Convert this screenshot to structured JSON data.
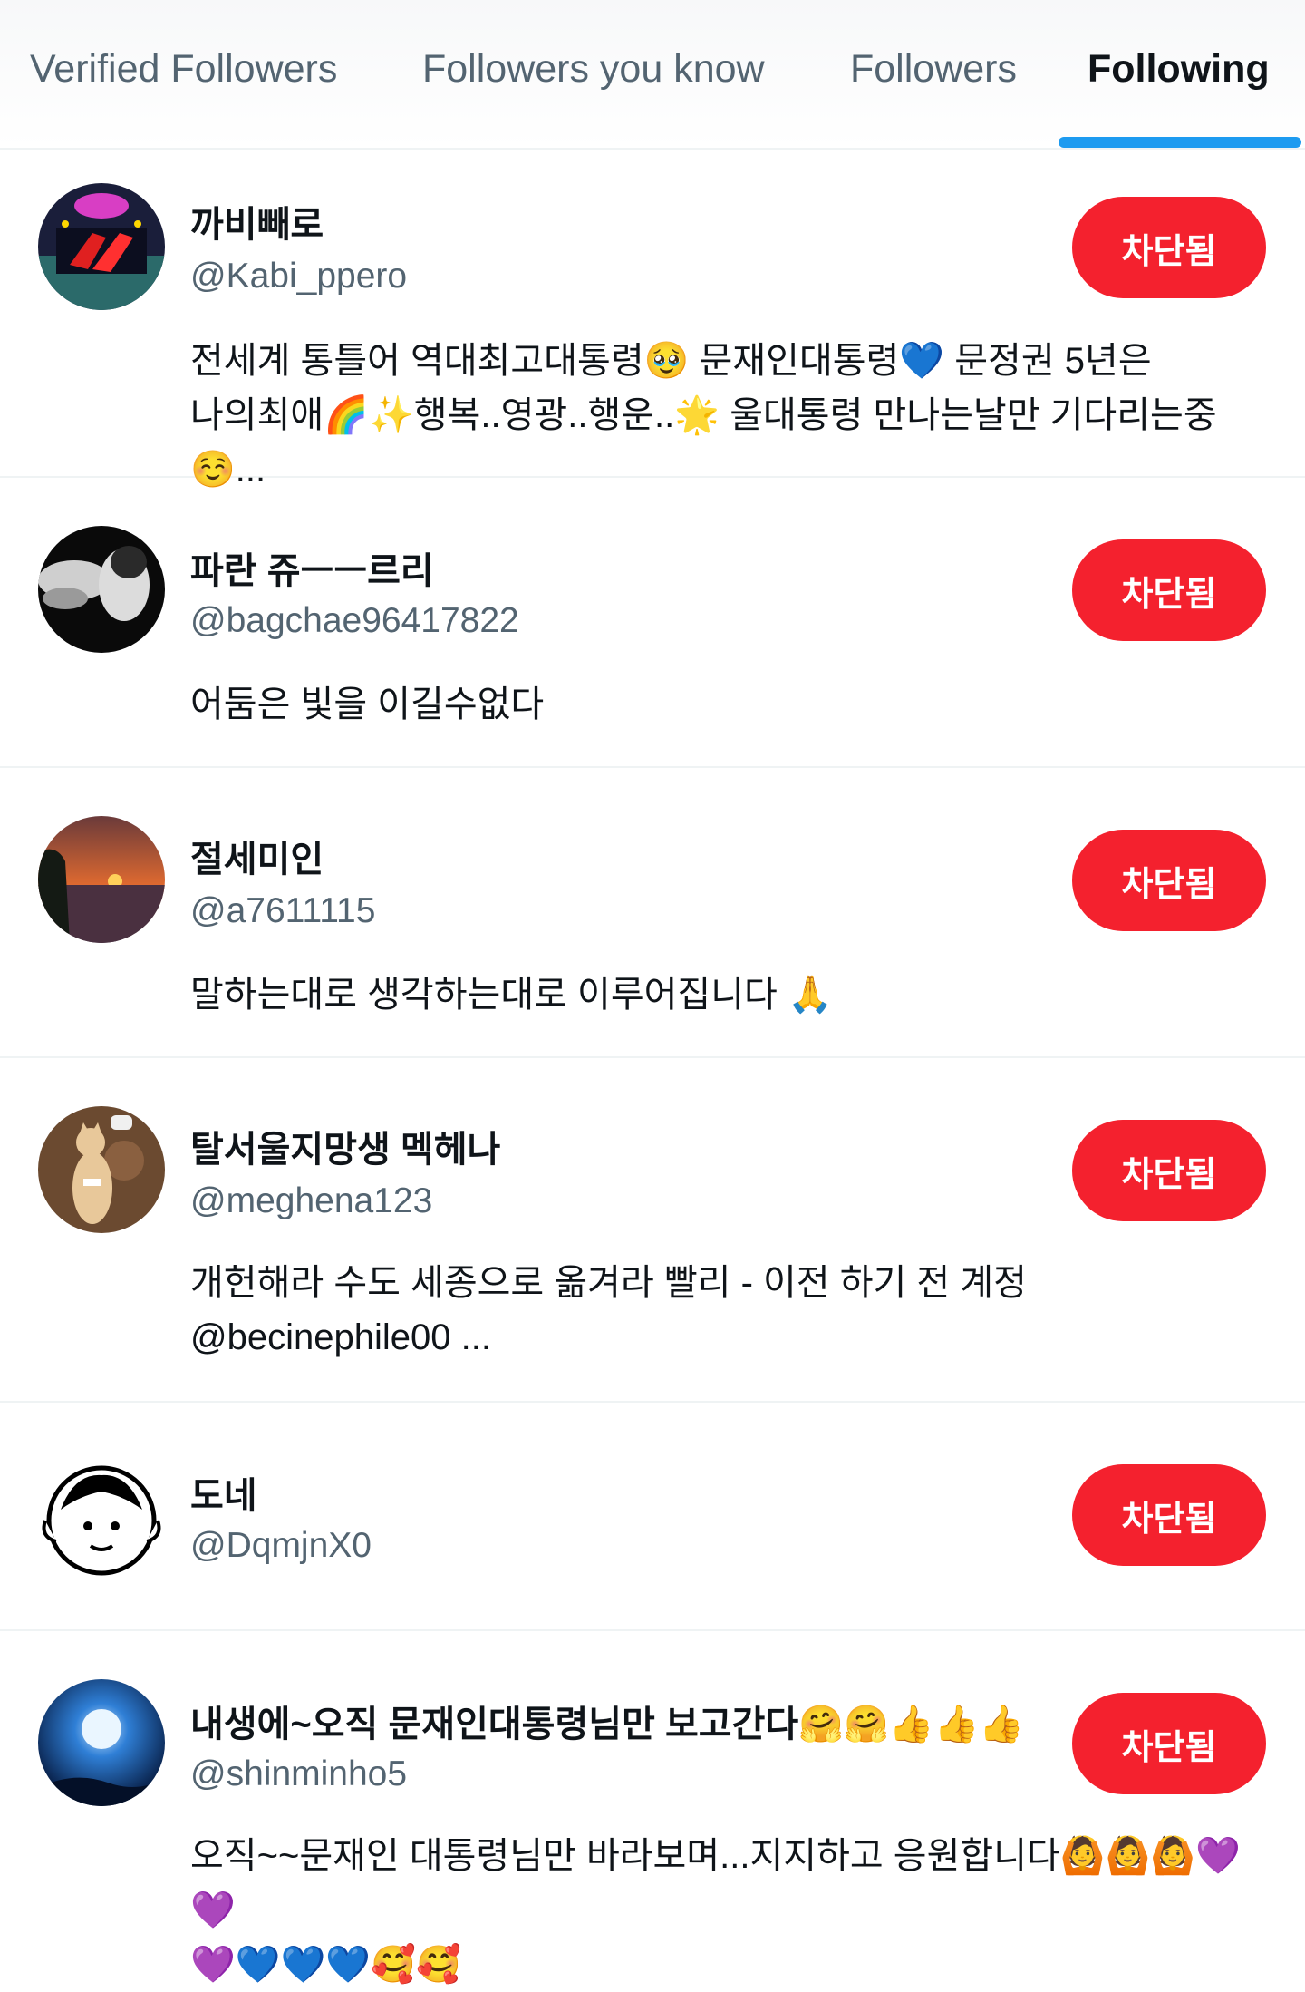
{
  "tabs": [
    {
      "label": "Verified Followers"
    },
    {
      "label": "Followers you know"
    },
    {
      "label": "Followers"
    },
    {
      "label": "Following"
    }
  ],
  "active_tab": "Following",
  "accent_color": "#1d9bf0",
  "block_button_color": "#f4212e",
  "users": [
    {
      "name": "까비빼로",
      "handle": "@Kabi_ppero",
      "bio": "전세계 통틀어 역대최고대통령🥹 문재인대통령💙 문정권 5년은\n나의최애🌈✨행복..영광..행운..🌟 울대통령 만나는날만 기다리는중☺️...",
      "button": "차단됨"
    },
    {
      "name": "파란 쥬ㅡㅡ르리",
      "handle": "@bagchae96417822",
      "bio": "어둠은 빛을 이길수없다",
      "button": "차단됨"
    },
    {
      "name": "절세미인",
      "handle": "@a7611115",
      "bio": "말하는대로 생각하는대로 이루어집니다 🙏",
      "button": "차단됨"
    },
    {
      "name": "탈서울지망생 멕헤나",
      "handle": "@meghena123",
      "bio": "개헌해라 수도 세종으로 옮겨라 빨리 - 이전 하기 전 계정\n@becinephile00                    ...",
      "button": "차단됨"
    },
    {
      "name": "도네",
      "handle": "@DqmjnX0",
      "bio": "",
      "button": "차단됨"
    },
    {
      "name": "내생에~오직 문재인대통령님만 보고간다🤗🤗👍👍👍",
      "handle": "@shinminho5",
      "bio": "오직~~문재인 대통령님만 바라보며...지지하고 응원합니다🙆🙆🙆💜💜\n💜💙💙💙🥰🥰",
      "button": "차단됨"
    }
  ]
}
